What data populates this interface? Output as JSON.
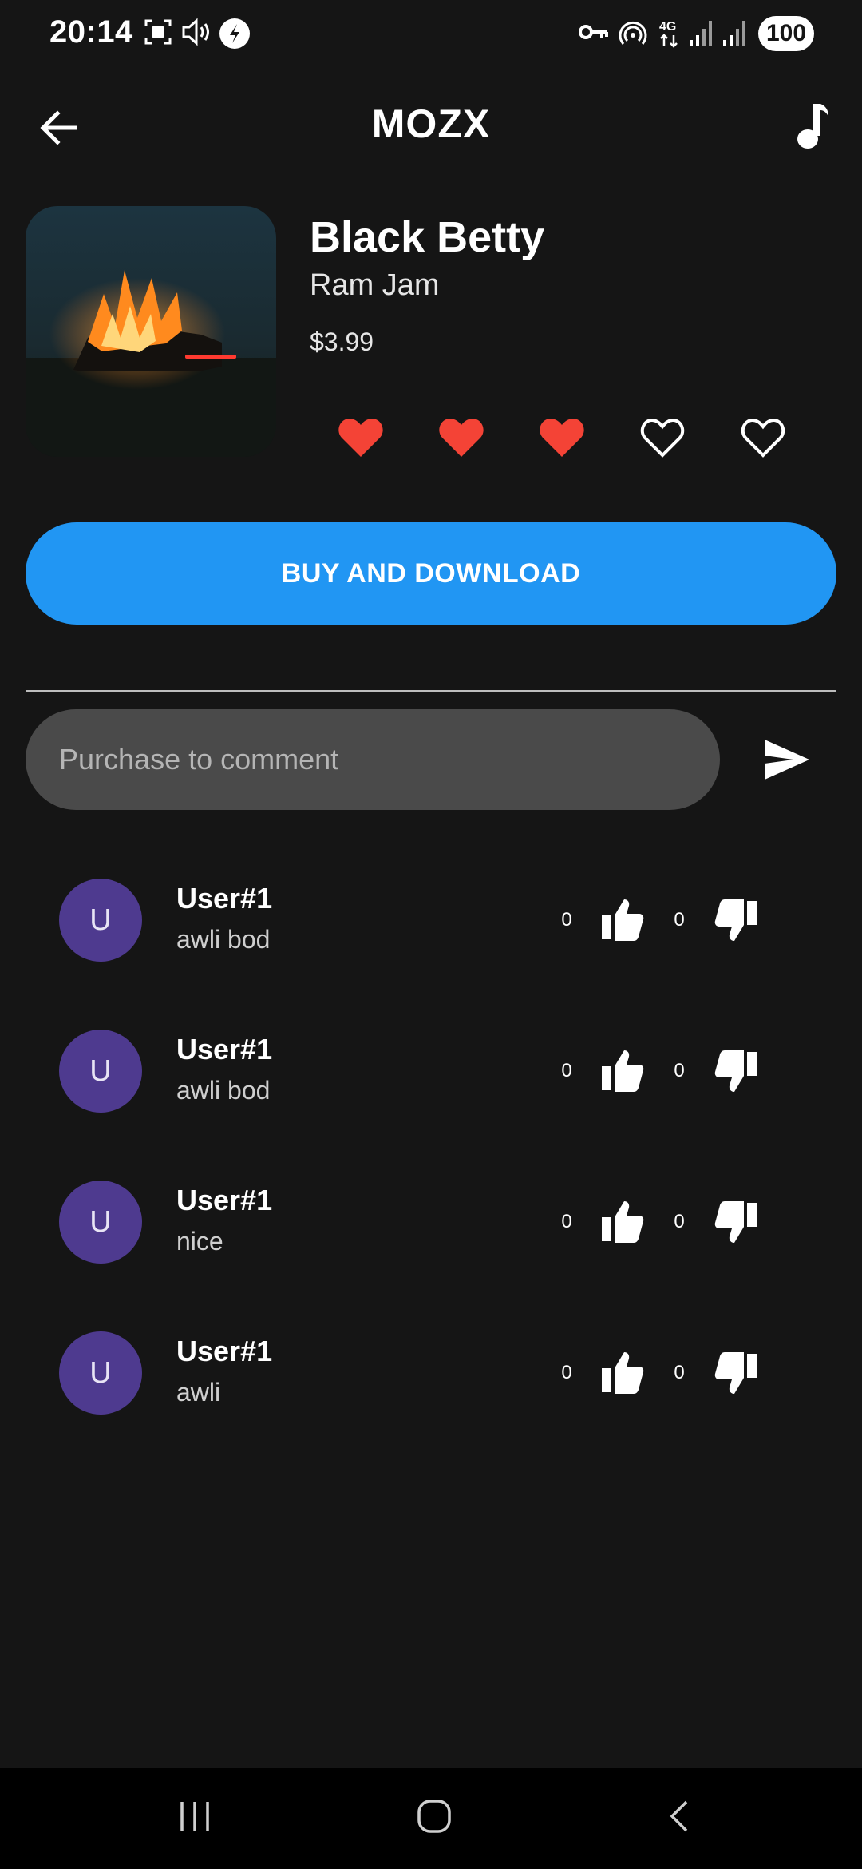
{
  "status_bar": {
    "time": "20:14",
    "battery": "100"
  },
  "app_bar": {
    "title": "MOZX"
  },
  "song": {
    "title": "Black Betty",
    "artist": "Ram Jam",
    "price": "$3.99",
    "rating": 3,
    "rating_max": 5
  },
  "buy_button": {
    "label": "BUY AND DOWNLOAD"
  },
  "comment_box": {
    "placeholder": "Purchase to comment"
  },
  "comments": [
    {
      "avatar": "U",
      "user": "User#1",
      "text": "awli bod",
      "likes": "0",
      "dislikes": "0"
    },
    {
      "avatar": "U",
      "user": "User#1",
      "text": "awli bod",
      "likes": "0",
      "dislikes": "0"
    },
    {
      "avatar": "U",
      "user": "User#1",
      "text": "nice",
      "likes": "0",
      "dislikes": "0"
    },
    {
      "avatar": "U",
      "user": "User#1",
      "text": "awli",
      "likes": "0",
      "dislikes": "0"
    }
  ],
  "colors": {
    "background": "#151515",
    "accent": "#2196f3",
    "heart_filled": "#f44336",
    "avatar": "#4e3a8f",
    "input_bg": "#4a4a4a"
  },
  "icons": [
    "back-arrow-icon",
    "music-note-icon",
    "heart-icon",
    "send-icon",
    "thumb-up-icon",
    "thumb-down-icon"
  ]
}
